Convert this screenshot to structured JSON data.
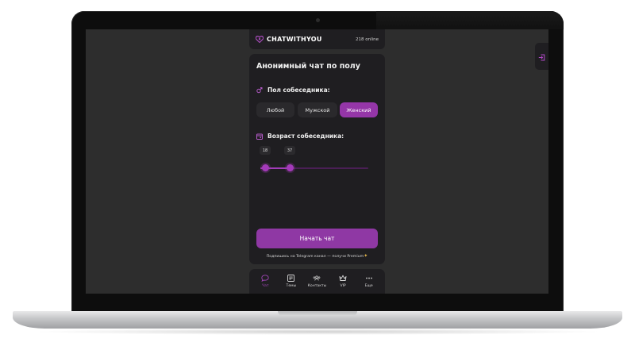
{
  "app": {
    "logo_text": "CHATWITHYOU",
    "online": "218 online"
  },
  "card": {
    "title": "Анонимный чат по полу",
    "gender_label": "Пол собеседника:",
    "gender_options": [
      "Любой",
      "Мужской",
      "Женский"
    ],
    "gender_selected": "Женский",
    "age_label": "Возраст собеседника:",
    "age_min": "18",
    "age_max": "37",
    "start_button": "Начать чат",
    "promo": "Подпишись на Telegram канал — получи Premium"
  },
  "nav": {
    "items": [
      {
        "label": "Чат",
        "icon": "chat-bubble-icon"
      },
      {
        "label": "Темы",
        "icon": "topics-icon"
      },
      {
        "label": "Контакты",
        "icon": "contacts-icon"
      },
      {
        "label": "VIP",
        "icon": "crown-icon"
      },
      {
        "label": "Еще",
        "icon": "more-icon"
      }
    ]
  },
  "colors": {
    "accent": "#9536a8",
    "panel": "#1f1e21",
    "background": "#2d2d2d"
  }
}
